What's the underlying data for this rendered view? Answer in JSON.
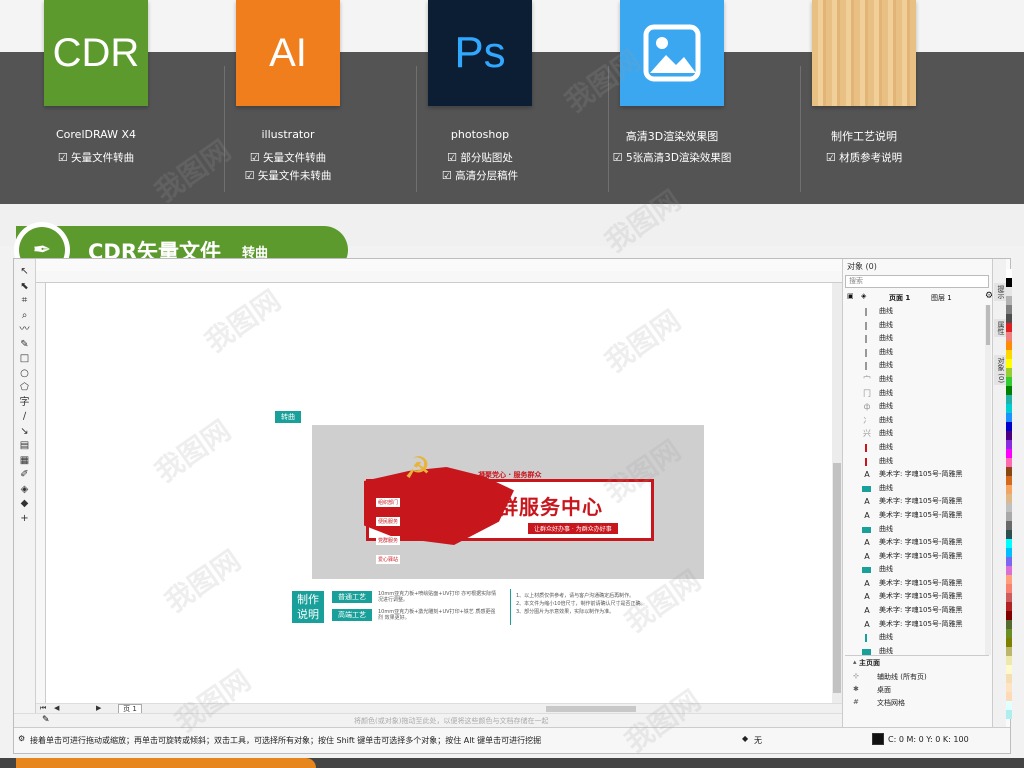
{
  "header_items": [
    {
      "tile_text": "CDR",
      "tile_color": "#5c9a2e",
      "caption": "CorelDRAW X4",
      "checks": [
        "矢量文件转曲"
      ]
    },
    {
      "tile_text": "AI",
      "tile_color": "#f07e1c",
      "caption": "illustrator",
      "checks": [
        "矢量文件转曲",
        "矢量文件未转曲"
      ]
    },
    {
      "tile_text": "Ps",
      "tile_color": "#0c1e33",
      "caption": "photoshop",
      "checks": [
        "部分贴图处",
        "高清分层稿件"
      ]
    },
    {
      "tile_text": "",
      "tile_color": "#3aa7f0",
      "caption": "高清3D渲染效果图",
      "checks": [
        "5张高清3D渲染效果图"
      ]
    },
    {
      "tile_text": "",
      "tile_color": "#e9c58e",
      "caption": "制作工艺说明",
      "checks": [
        "材质参考说明"
      ]
    }
  ],
  "section": {
    "title": "CDR矢量文件",
    "subtitle": "转曲"
  },
  "design": {
    "tag": "转曲",
    "title": "党群服务中心",
    "slogan_top": "凝聚党心 · 服务群众",
    "slogan_bottom": "让群众好办事 · 为群众办好事",
    "side_tags": [
      "组织部门",
      "便民服务",
      "党群服务",
      "爱心驿站"
    ],
    "notes_badge": [
      "制作",
      "说明"
    ],
    "process": [
      {
        "label": "普通工艺",
        "desc": "10mm亚克力板+喷绘贴面+UV打印 亦可根据实际情况进行调整。"
      },
      {
        "label": "高端工艺",
        "desc": "10mm亚克力板+激光雕刻+UV打印+铁艺 质感更强烈 效果更好。"
      }
    ],
    "remarks": [
      "1、以上材质仅供参考，请与客户沟通确定后再制作。",
      "2、本文件为缩小10倍尺寸，制作前请确认尺寸是否正确。",
      "3、部分图片为示意效果，实际以制作为准。"
    ]
  },
  "status": {
    "tip": "接着单击可进行拖动或缩放；再单击可旋转或倾斜；双击工具，可选择所有对象；按住 Shift 键单击可选择多个对象；按住 Alt 键单击可进行挖掘",
    "hint": "将颜色(或对象)拖动至此处，以便将这些颜色与文档存储在一起",
    "fill_label": "无",
    "cmyk": "C: 0 M: 0 Y: 0 K: 100",
    "page_tab": "页 1"
  },
  "docker": {
    "title": "对象 (0)",
    "search_placeholder": "搜索",
    "page": "页面 1",
    "layer": "图层 1",
    "objects": [
      {
        "kind": "bar",
        "color": "#999999",
        "label": "曲线"
      },
      {
        "kind": "bar",
        "color": "#999999",
        "label": "曲线"
      },
      {
        "kind": "bar",
        "color": "#999999",
        "label": "曲线"
      },
      {
        "kind": "bar",
        "color": "#999999",
        "label": "曲线"
      },
      {
        "kind": "bar",
        "color": "#999999",
        "label": "曲线"
      },
      {
        "kind": "glyph",
        "glyph": "宀",
        "label": "曲线"
      },
      {
        "kind": "glyph",
        "glyph": "冂",
        "label": "曲线"
      },
      {
        "kind": "glyph",
        "glyph": "ф",
        "label": "曲线"
      },
      {
        "kind": "glyph",
        "glyph": "冫",
        "label": "曲线"
      },
      {
        "kind": "glyph",
        "glyph": "兴",
        "label": "曲线"
      },
      {
        "kind": "bar",
        "color": "#c8161d",
        "label": "曲线"
      },
      {
        "kind": "bar",
        "color": "#c8161d",
        "label": "曲线"
      },
      {
        "kind": "text",
        "label": "美术字: 字魂105号-简雅黑"
      },
      {
        "kind": "block",
        "label": "曲线"
      },
      {
        "kind": "text",
        "label": "美术字: 字魂105号-简雅黑"
      },
      {
        "kind": "text",
        "label": "美术字: 字魂105号-简雅黑"
      },
      {
        "kind": "block",
        "label": "曲线"
      },
      {
        "kind": "text",
        "label": "美术字: 字魂105号-简雅黑"
      },
      {
        "kind": "text",
        "label": "美术字: 字魂105号-简雅黑"
      },
      {
        "kind": "block",
        "label": "曲线"
      },
      {
        "kind": "text",
        "label": "美术字: 字魂105号-简雅黑"
      },
      {
        "kind": "text",
        "label": "美术字: 字魂105号-简雅黑"
      },
      {
        "kind": "text",
        "label": "美术字: 字魂105号-简雅黑"
      },
      {
        "kind": "text",
        "label": "美术字: 字魂105号-简雅黑"
      },
      {
        "kind": "bar",
        "color": "#1aa09a",
        "label": "曲线"
      },
      {
        "kind": "block",
        "label": "曲线"
      }
    ],
    "master_title": "主页面",
    "master_rows": [
      "辅助线 (所有页)",
      "桌面",
      "文档网格"
    ],
    "side_tabs": [
      "提示",
      "属性",
      "对象 (0)"
    ]
  },
  "watermark": "我图网",
  "palette": [
    "#ffffff",
    "#000000",
    "#e6e6e6",
    "#b3b3b3",
    "#808080",
    "#4d4d4d",
    "#e02020",
    "#f08080",
    "#ff8c00",
    "#ffd700",
    "#ffff00",
    "#9acd32",
    "#32cd32",
    "#008000",
    "#20b2aa",
    "#00ced1",
    "#1e90ff",
    "#0000cd",
    "#4b0082",
    "#8a2be2",
    "#ff00ff",
    "#ff69b4",
    "#8b4513",
    "#d2691e",
    "#f4a460",
    "#deb887",
    "#c0c0c0",
    "#a9a9a9",
    "#696969",
    "#2f4f4f",
    "#00ffff",
    "#00bfff",
    "#7b68ee",
    "#da70d6",
    "#ffa07a",
    "#fa8072",
    "#cd5c5c",
    "#b22222",
    "#800000",
    "#556b2f",
    "#6b8e23",
    "#808000",
    "#bdb76b",
    "#eee8aa",
    "#fffacd",
    "#f5deb3",
    "#ffe4c4",
    "#ffdab9",
    "#e0ffff",
    "#afeeee"
  ]
}
